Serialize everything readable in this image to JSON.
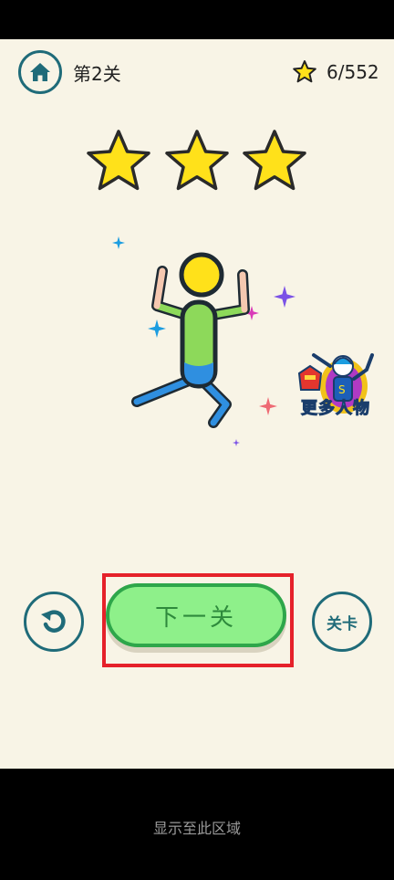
{
  "header": {
    "level_title": "第2关",
    "star_count": "6/552"
  },
  "result": {
    "stars_earned": 3,
    "stars_total": 3
  },
  "promo": {
    "more_characters_label": "更多人物"
  },
  "actions": {
    "next_level_label": "下一关",
    "levels_label": "关卡"
  },
  "footer": {
    "display_area_text": "显示至此区域"
  },
  "colors": {
    "background": "#f8f4e6",
    "accent": "#1f6b79",
    "star": "#ffe11a",
    "next_button": "#8ef08a",
    "highlight": "#e5212a"
  },
  "icons": [
    "home-icon",
    "star-icon",
    "undo-icon",
    "stick-figure-character",
    "sparkle-icon",
    "more-characters-icon"
  ]
}
